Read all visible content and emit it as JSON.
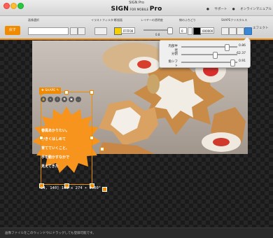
{
  "window": {
    "title": "SIGN Pro",
    "logo_main": "SIGN",
    "logo_small": " FOR MOBILE ",
    "logo_suffix": "Pro"
  },
  "top_links": {
    "support": "サポート",
    "online": "オンラインマニュアル"
  },
  "toolbar": {
    "back_label": "戻す",
    "image_select_label": "画像選択",
    "filter_label": "イラストフィルター",
    "shadow_label": "影描画",
    "layer_opacity_label": "レイヤーの透明度",
    "opacity_value": "0.8",
    "line_label": "線のふちどり",
    "line_width": "0",
    "line_color_hex": "000000",
    "shadow_color_hex": "FFFF00",
    "shape_label": "SHAPEクリスタルス",
    "effect_label": "エフェクト"
  },
  "popover": {
    "rows": [
      {
        "label": "内部半径",
        "value": "0.86",
        "fraction": 0.86
      },
      {
        "label": "分割",
        "value": "62.37",
        "fraction": 0.6
      },
      {
        "label": "角シフト",
        "value": "0.91",
        "fraction": 0.91
      }
    ],
    "marks": [
      "0.5",
      "1.0"
    ]
  },
  "canvas": {
    "photo_credit": "coffee-recipes.com/mp/photo",
    "shape_tag": "SHAPE",
    "burst_lines": [
      "春風あかりたい。",
      "かきくはしめて",
      "育てていくこと、",
      "手を動かすなかで",
      "見えてきた"
    ],
    "coords_readout": "24, 140] 103 x 274 • 0.00°"
  },
  "status": {
    "message": "画像ファイルをこのウィンドウにドラッグしても登録可能です。"
  },
  "colors": {
    "accent": "#f08a00",
    "burst": "#f7941d"
  }
}
